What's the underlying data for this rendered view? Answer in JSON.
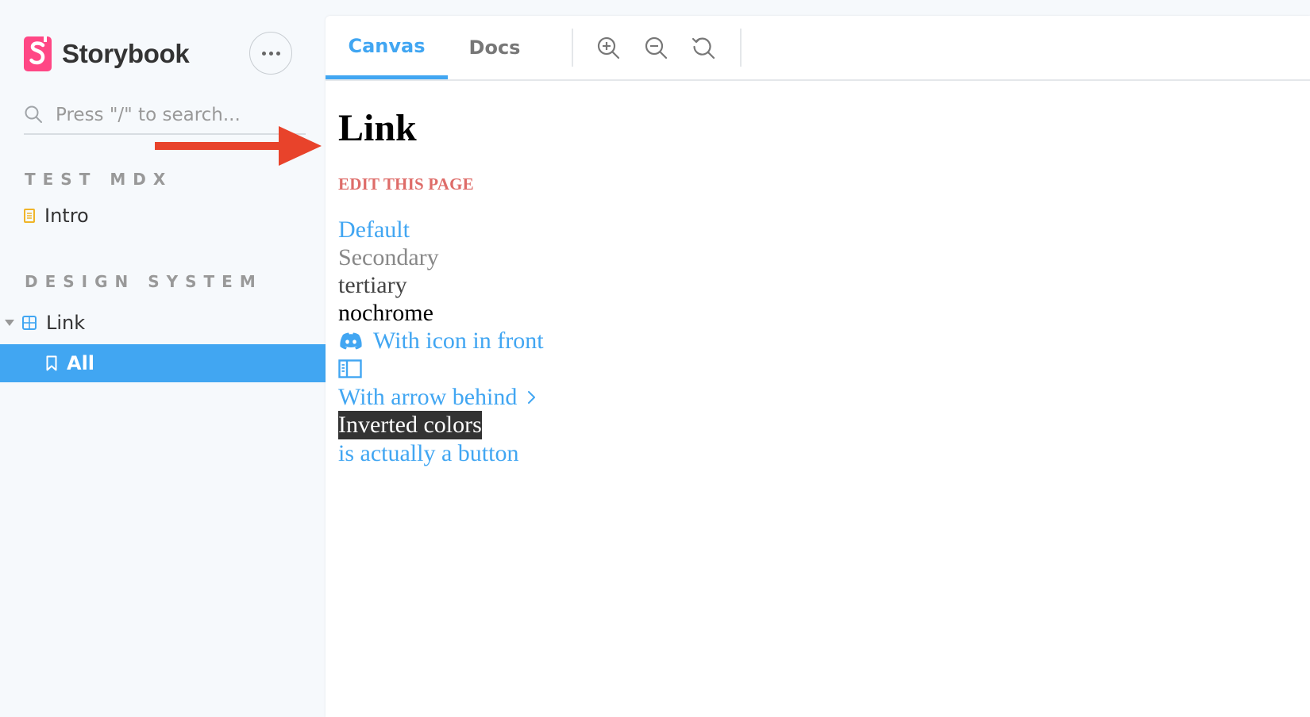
{
  "sidebar": {
    "brand_name": "Storybook",
    "search": {
      "placeholder": "Press \"/\" to search..."
    },
    "groups": [
      {
        "title": "TEST MDX",
        "items": [
          {
            "label": "Intro",
            "icon": "document-icon"
          }
        ]
      },
      {
        "title": "DESIGN SYSTEM",
        "items": [
          {
            "label": "Link",
            "icon": "component-icon",
            "expanded": true,
            "children": [
              {
                "label": "All",
                "icon": "bookmark-icon",
                "selected": true
              }
            ]
          }
        ]
      }
    ]
  },
  "toolbar": {
    "tabs": [
      {
        "label": "Canvas",
        "active": true
      },
      {
        "label": "Docs",
        "active": false
      }
    ],
    "tools": [
      "zoom-in-icon",
      "zoom-out-icon",
      "reset-zoom-icon"
    ]
  },
  "story": {
    "title": "Link",
    "edit_link": "EDIT THIS PAGE",
    "links": {
      "default": "Default",
      "secondary": "Secondary",
      "tertiary": "tertiary",
      "nochrome": "nochrome",
      "with_icon": "With icon in front",
      "with_arrow": "With arrow behind",
      "inverted": "Inverted colors",
      "button": "is actually a button"
    }
  },
  "colors": {
    "accent": "#41a6f2",
    "brand": "#ff4785",
    "annotation_arrow": "#e8432b",
    "edit_link": "#d9534f"
  }
}
